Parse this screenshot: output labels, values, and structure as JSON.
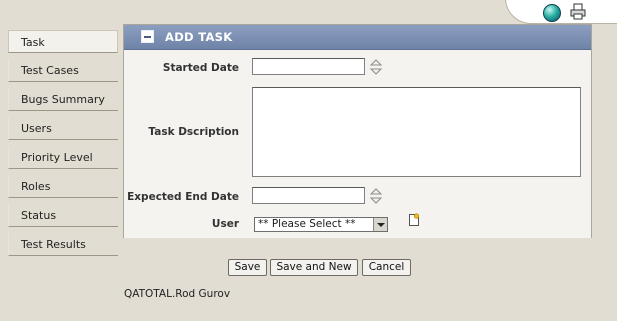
{
  "sidebar": {
    "items": [
      {
        "label": "Task",
        "active": true
      },
      {
        "label": "Test Cases"
      },
      {
        "label": "Bugs Summary"
      },
      {
        "label": "Users"
      },
      {
        "label": "Priority Level"
      },
      {
        "label": "Roles"
      },
      {
        "label": "Status"
      },
      {
        "label": "Test Results"
      }
    ]
  },
  "panel": {
    "title": "ADD TASK",
    "fields": {
      "started_date": {
        "label": "Started Date",
        "value": ""
      },
      "task_description": {
        "label": "Task Dscription",
        "value": ""
      },
      "expected_end_date": {
        "label": "Expected End Date",
        "value": ""
      },
      "user": {
        "label": "User",
        "selected": "** Please Select **"
      }
    }
  },
  "buttons": {
    "save": "Save",
    "save_and_new": "Save and New",
    "cancel": "Cancel"
  },
  "footer": {
    "user_info": "QATOTAL.Rod Gurov"
  },
  "icons": {
    "header_globe": "globe-icon",
    "header_print": "printer-icon",
    "spinner": "spinner-arrows-icon",
    "add_user": "new-document-icon"
  },
  "colors": {
    "page_bg": "#e2ddd2",
    "panel_header": "#7a8db1",
    "panel_body": "#f4f3ef"
  }
}
